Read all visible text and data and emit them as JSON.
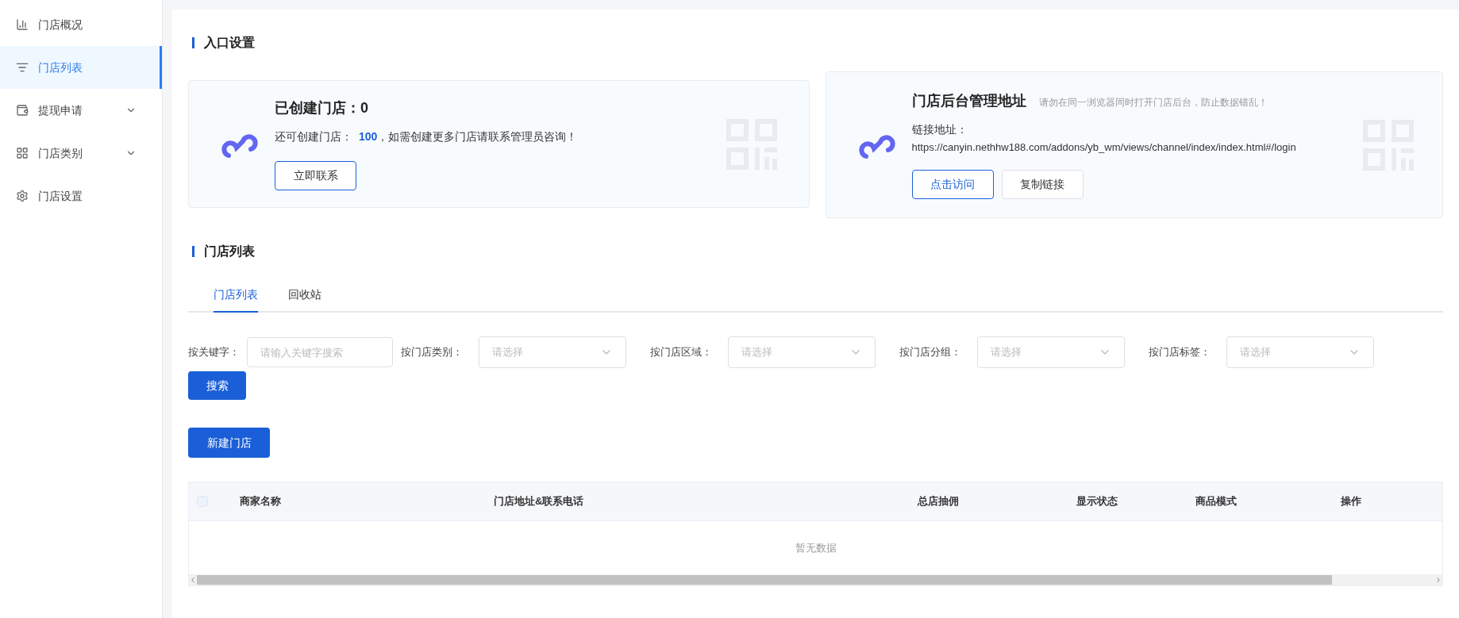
{
  "sidebar": {
    "items": [
      {
        "label": "门店概况",
        "kind": "chart",
        "selected": false,
        "expandable": false
      },
      {
        "label": "门店列表",
        "kind": "list",
        "selected": true,
        "expandable": false
      },
      {
        "label": "提现申请",
        "kind": "wallet",
        "selected": false,
        "expandable": true
      },
      {
        "label": "门店类别",
        "kind": "grid",
        "selected": false,
        "expandable": true
      },
      {
        "label": "门店设置",
        "kind": "gear",
        "selected": false,
        "expandable": false
      }
    ]
  },
  "entry_section": {
    "title": "入口设置",
    "created_card": {
      "title": "已创建门店：0",
      "capacity_prefix": "还可创建门店：",
      "capacity_count": "100",
      "capacity_suffix": "，如需创建更多门店请联系管理员咨询！",
      "button": "立即联系"
    },
    "admin_card": {
      "title": "门店后台管理地址",
      "hint": "请勿在同一浏览器同时打开门店后台，防止数据错乱！",
      "link_label": "链接地址：",
      "link_url": "https://canyin.nethhw188.com/addons/yb_wm/views/channel/index/index.html#/login",
      "buttons": [
        {
          "label": "点击访问",
          "kind": "primary"
        },
        {
          "label": "复制链接",
          "kind": "default"
        }
      ]
    }
  },
  "list_section": {
    "title": "门店列表",
    "tabs": [
      {
        "label": "门店列表",
        "selected": true
      },
      {
        "label": "回收站",
        "selected": false
      }
    ],
    "filters": [
      {
        "label": "按关键字：",
        "kind": "input",
        "placeholder": "请输入关键字搜索"
      },
      {
        "label": "按门店类别：",
        "kind": "select",
        "placeholder": "请选择"
      },
      {
        "label": "按门店区域：",
        "kind": "select",
        "placeholder": "请选择"
      },
      {
        "label": "按门店分组：",
        "kind": "select",
        "placeholder": "请选择"
      },
      {
        "label": "按门店标签：",
        "kind": "select",
        "placeholder": "请选择"
      }
    ],
    "search_button": "搜索",
    "new_button": "新建门店",
    "table": {
      "select_all_checked": false,
      "columns": [
        "商家名称",
        "门店地址&联系电话",
        "总店抽佣",
        "显示状态",
        "商品模式",
        "操作"
      ],
      "empty_text": "暂无数据"
    }
  }
}
